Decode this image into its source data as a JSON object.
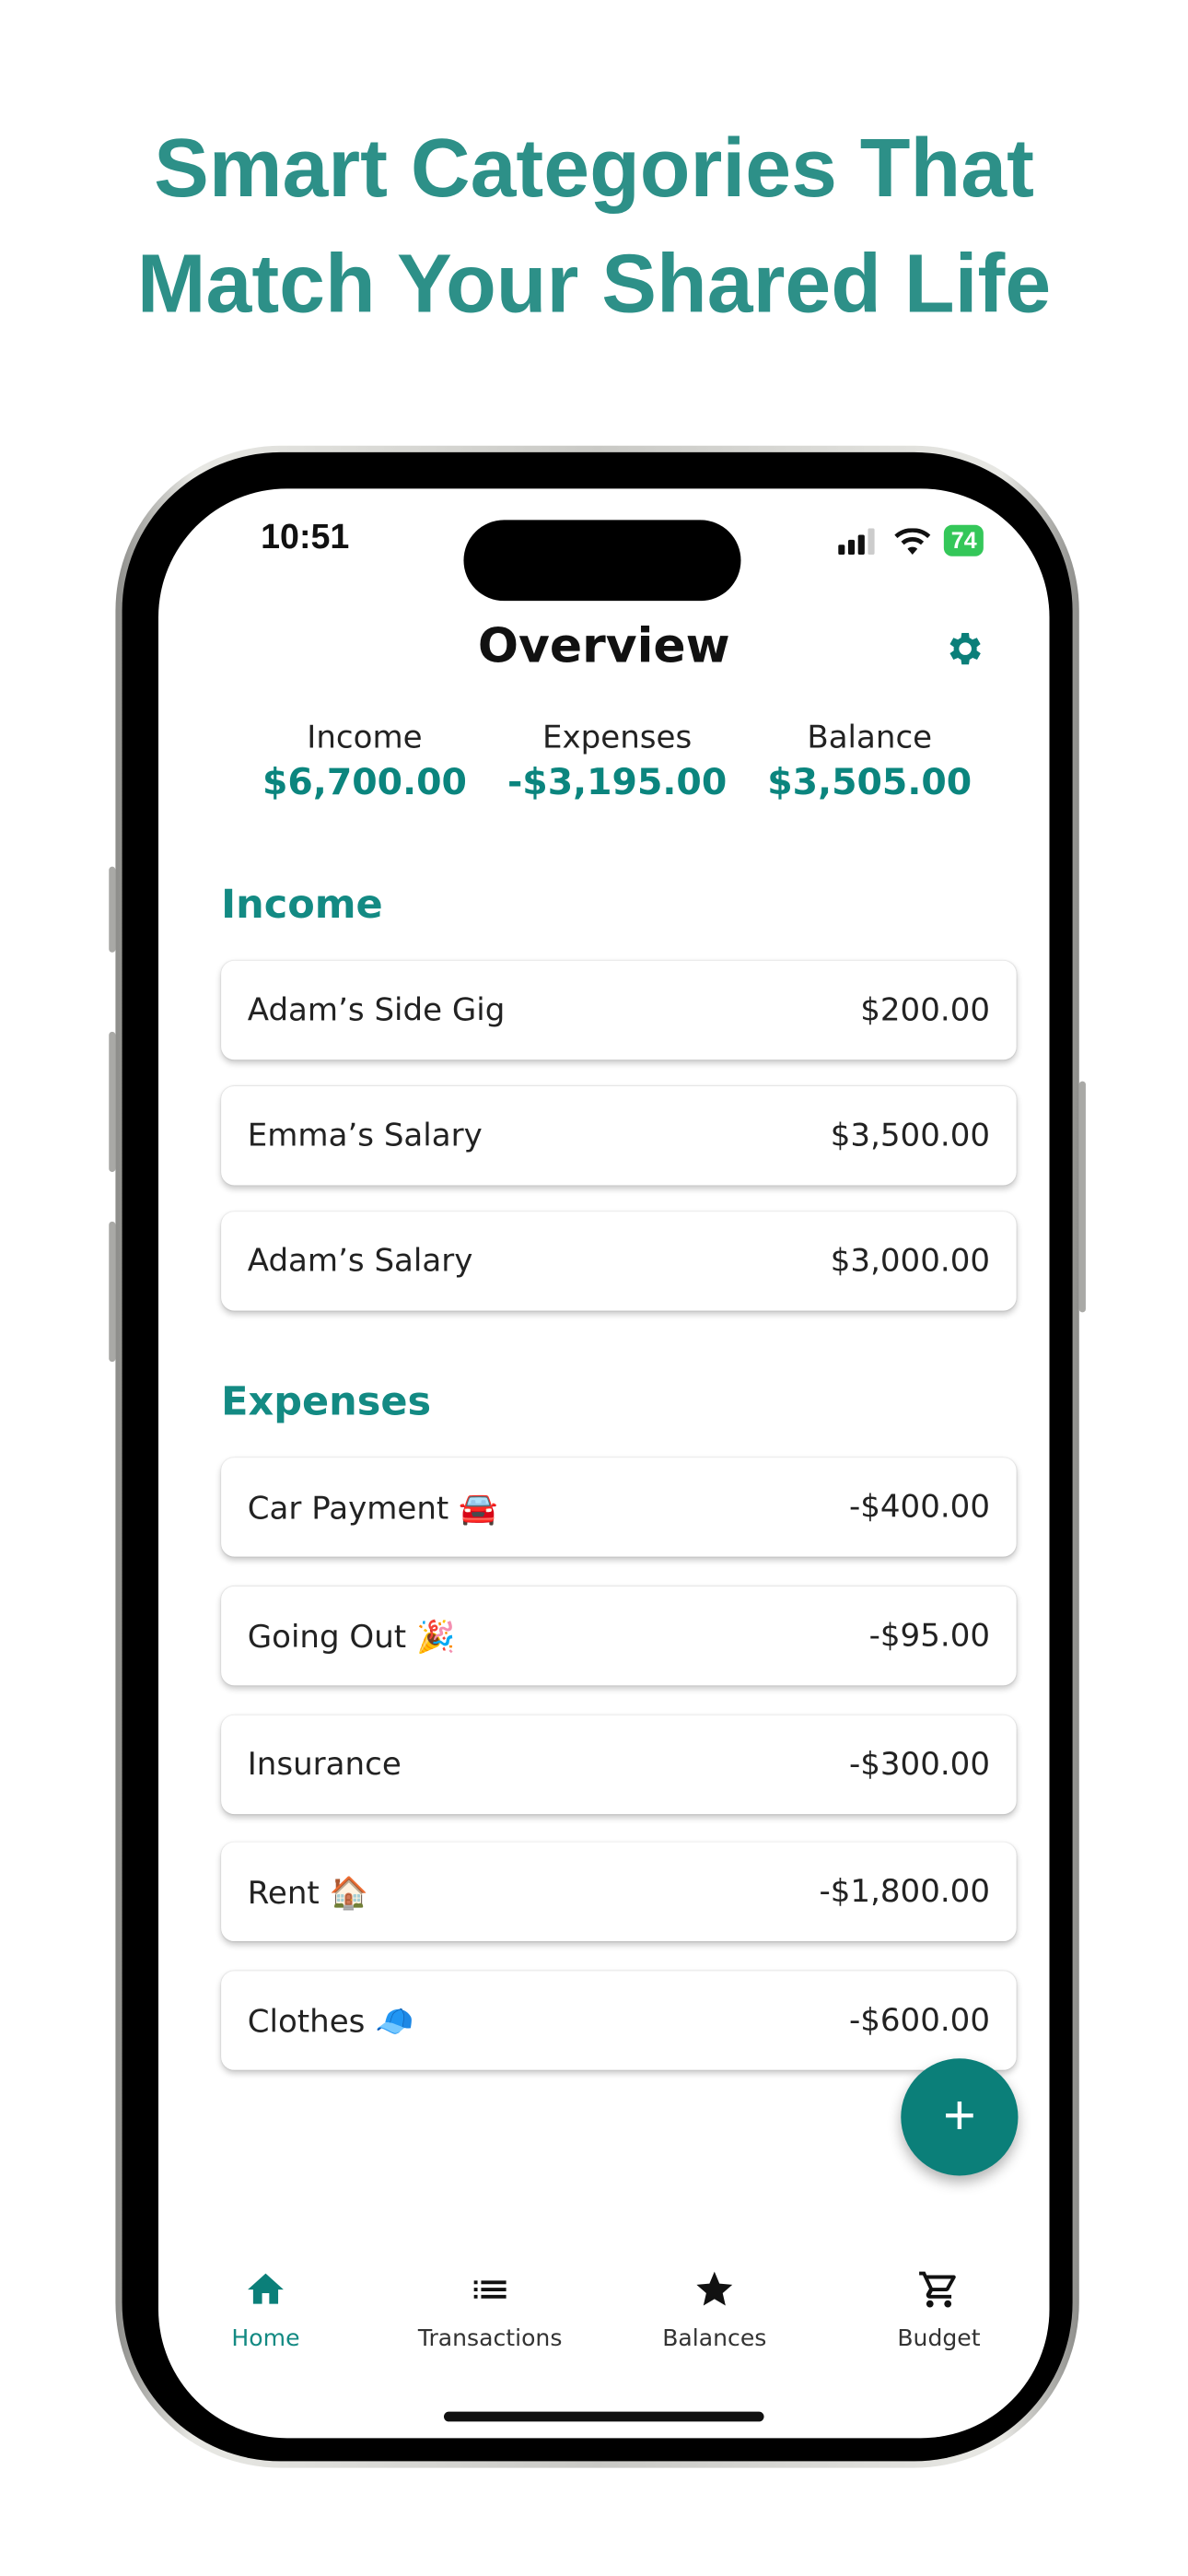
{
  "headline": {
    "line1": "Smart Categories That",
    "line2": "Match Your Shared Life"
  },
  "status_bar": {
    "time": "10:51",
    "battery": "74"
  },
  "header": {
    "title": "Overview",
    "settings_icon": "gear-icon"
  },
  "summary": [
    {
      "label": "Income",
      "value": "$6,700.00"
    },
    {
      "label": "Expenses",
      "value": "-$3,195.00"
    },
    {
      "label": "Balance",
      "value": "$3,505.00"
    }
  ],
  "income": {
    "title": "Income",
    "items": [
      {
        "name": "Adam’s Side Gig",
        "amount": "$200.00"
      },
      {
        "name": "Emma’s Salary",
        "amount": "$3,500.00"
      },
      {
        "name": "Adam’s Salary",
        "amount": "$3,000.00"
      }
    ]
  },
  "expenses": {
    "title": "Expenses",
    "items": [
      {
        "name": "Car Payment 🚘",
        "amount": "-$400.00"
      },
      {
        "name": "Going Out 🎉",
        "amount": "-$95.00"
      },
      {
        "name": "Insurance",
        "amount": "-$300.00"
      },
      {
        "name": "Rent 🏠",
        "amount": "-$1,800.00"
      },
      {
        "name": "Clothes 🧢",
        "amount": "-$600.00"
      }
    ]
  },
  "fab": {
    "label": "+"
  },
  "nav": [
    {
      "label": "Home",
      "icon": "home-icon"
    },
    {
      "label": "Transactions",
      "icon": "list-icon"
    },
    {
      "label": "Balances",
      "icon": "star-icon"
    },
    {
      "label": "Budget",
      "icon": "cart-icon"
    }
  ],
  "colors": {
    "accent": "#0b857e",
    "headline": "#2d9088"
  }
}
